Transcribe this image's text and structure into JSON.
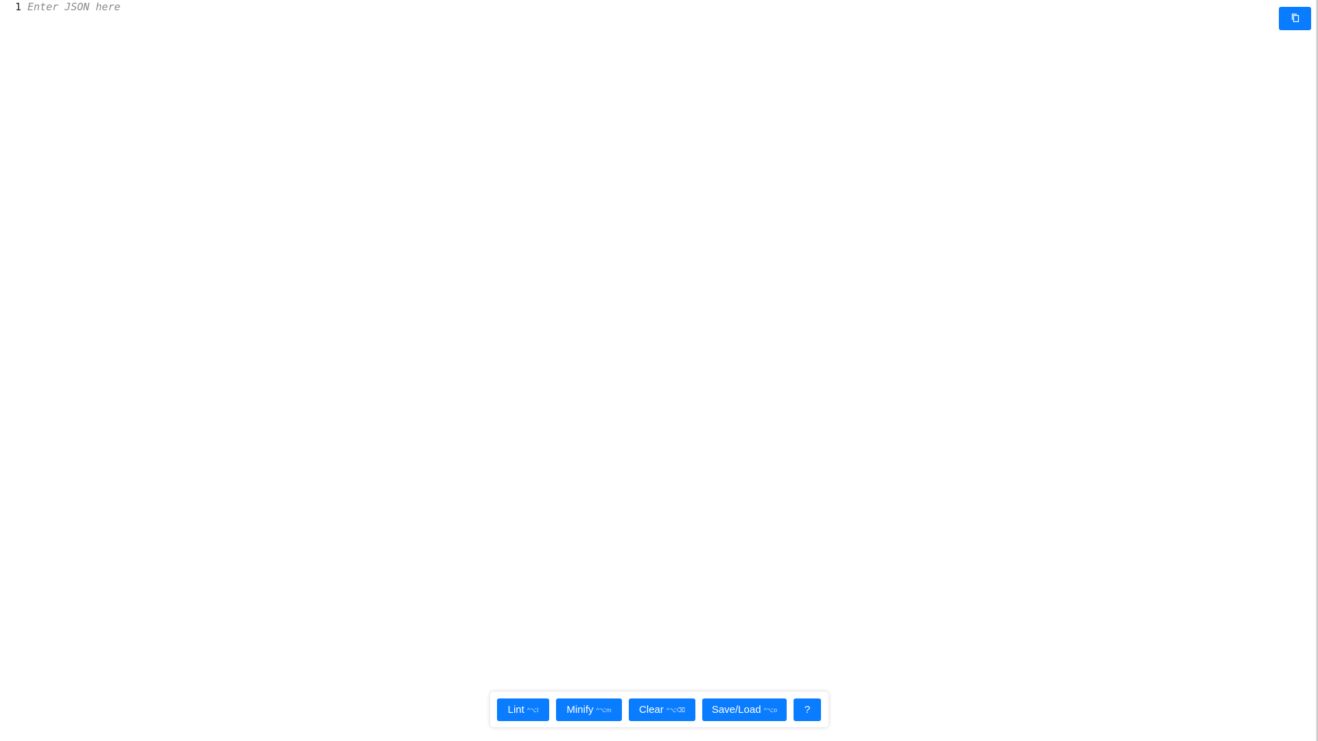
{
  "editor": {
    "line_number": "1",
    "placeholder": "Enter JSON here"
  },
  "copy_button": {
    "icon": "copy-icon"
  },
  "toolbar": {
    "buttons": [
      {
        "label": "Lint",
        "shortcut": "^⌥l"
      },
      {
        "label": "Minify",
        "shortcut": "^⌥m"
      },
      {
        "label": "Clear",
        "shortcut": "^⌥⌫"
      },
      {
        "label": "Save/Load",
        "shortcut": "^⌥o"
      },
      {
        "label": "?",
        "shortcut": ""
      }
    ]
  },
  "colors": {
    "accent": "#0a7cff",
    "background": "#ffffff",
    "placeholder": "#8a8a8a"
  }
}
